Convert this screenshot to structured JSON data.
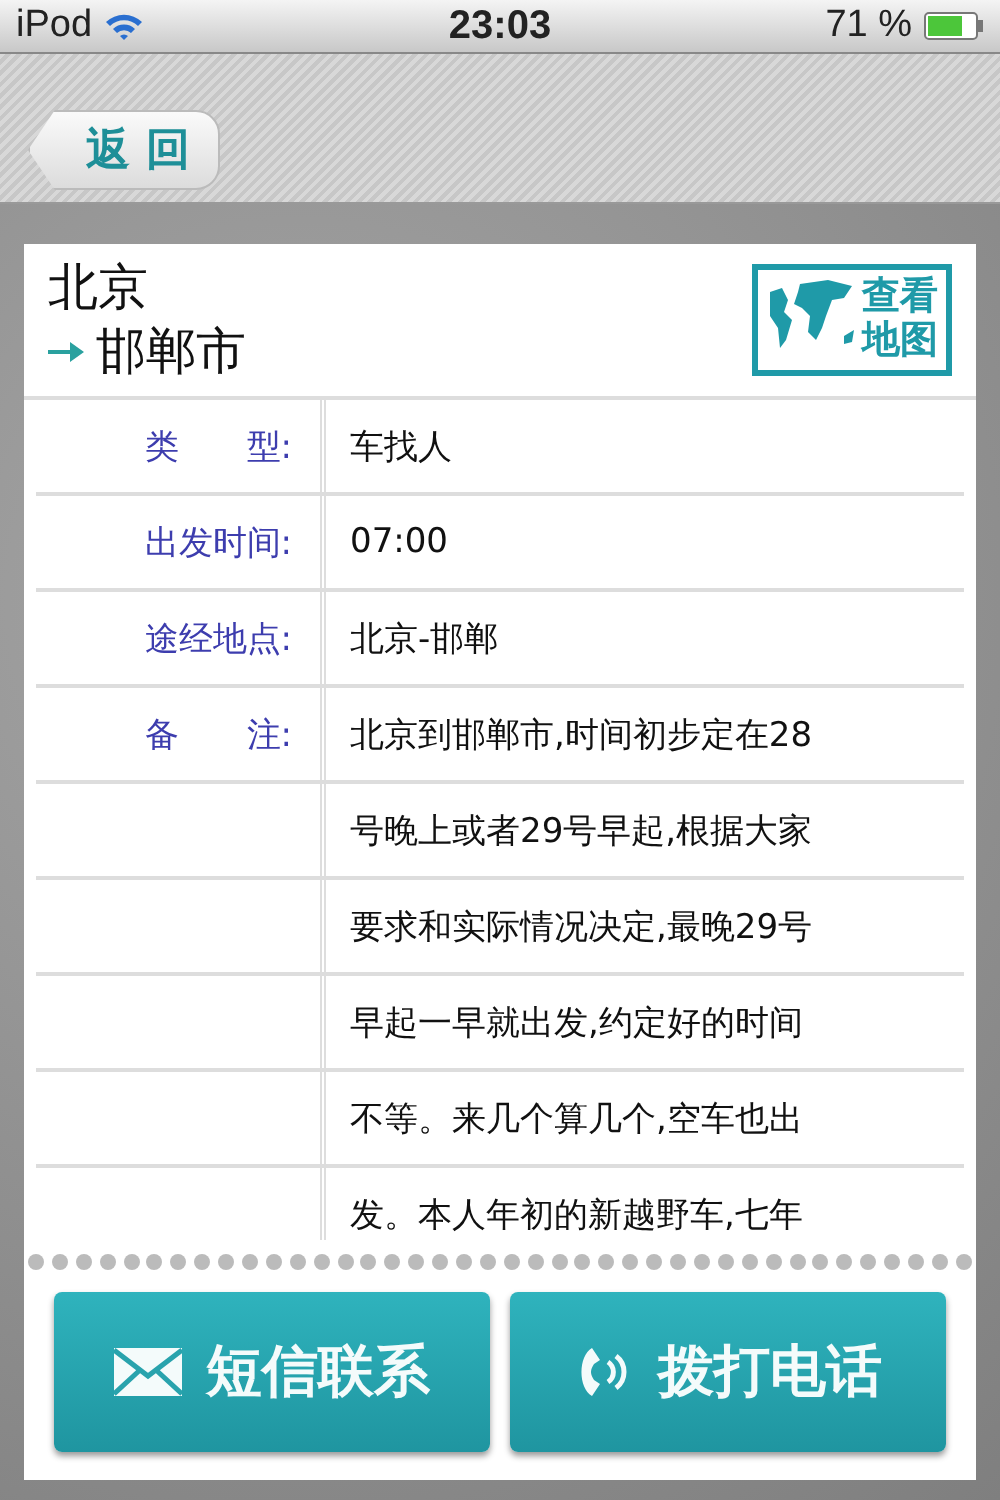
{
  "status_bar": {
    "carrier": "iPod",
    "time": "23:03",
    "battery": "71 %"
  },
  "nav": {
    "back": "返 回"
  },
  "route": {
    "from": "北京",
    "to": "邯郸市",
    "map_button": "查看地图"
  },
  "rows": [
    {
      "label": "类　　型:",
      "lines": [
        "车找人"
      ]
    },
    {
      "label": "出发时间:",
      "lines": [
        "07:00"
      ]
    },
    {
      "label": "途经地点:",
      "lines": [
        "北京-邯郸"
      ]
    },
    {
      "label": "备　　注:",
      "lines": [
        "北京到邯郸市,时间初步定在28",
        "号晚上或者29号早起,根据大家",
        "要求和实际情况决定,最晚29号",
        "早起一早就出发,约定好的时间",
        "不等。来几个算几个,空车也出",
        "发。本人年初的新越野车,七年"
      ]
    }
  ],
  "buttons": [
    {
      "kind": "sms",
      "label": "短信联系"
    },
    {
      "kind": "call",
      "label": "拨打电话"
    }
  ]
}
